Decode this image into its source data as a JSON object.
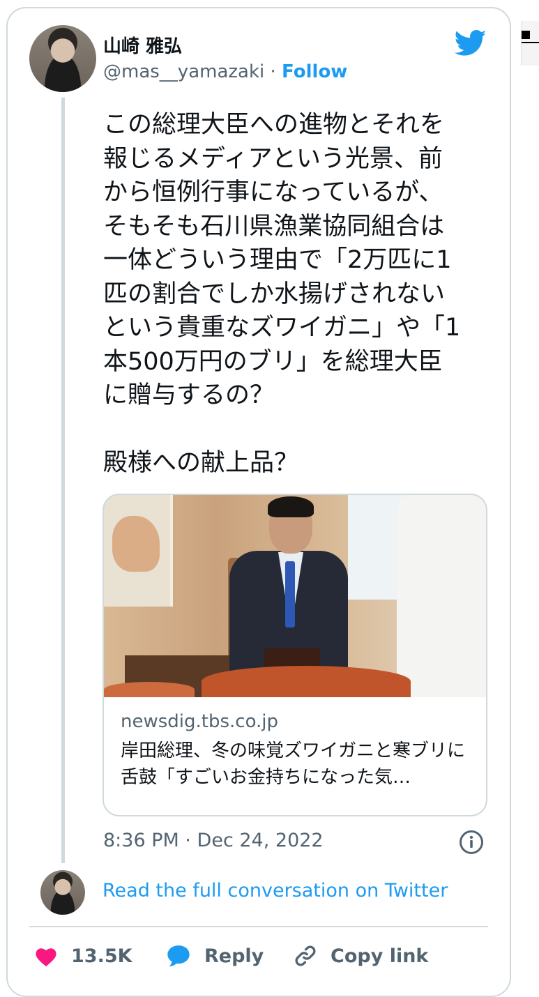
{
  "author": {
    "display_name": "山崎 雅弘",
    "handle": "@mas__yamazaki",
    "separator": " · ",
    "follow_label": "Follow"
  },
  "tweet": {
    "text": "この総理大臣への進物とそれを\n報じるメディアという光景、前\nから恒例行事になっているが、\nそもそも石川県漁業協同組合は\n一体どういう理由で「2万匹に1\n匹の割合でしか水揚げされない\nという貴重なズワイガニ」や「1\n本500万円のブリ」を総理大臣\nに贈与するの？\n\n殿様への献上品？",
    "timestamp": "8:36 PM · Dec 24, 2022"
  },
  "link_card": {
    "domain": "newsdig.tbs.co.jp",
    "title": "岸田総理、冬の味覚ズワイガニと寒ブリに舌鼓「すごいお金持ちになった気…"
  },
  "conversation": {
    "read_full_label": "Read the full conversation on Twitter"
  },
  "actions": {
    "like_count": "13.5K",
    "reply_label": "Reply",
    "copy_label": "Copy link"
  },
  "colors": {
    "accent": "#1d9bf0",
    "like": "#f91880",
    "muted": "#536471",
    "border": "#cfd9de"
  },
  "icons": [
    "twitter-bird-icon",
    "info-icon",
    "heart-icon",
    "reply-bubble-icon",
    "link-icon"
  ]
}
